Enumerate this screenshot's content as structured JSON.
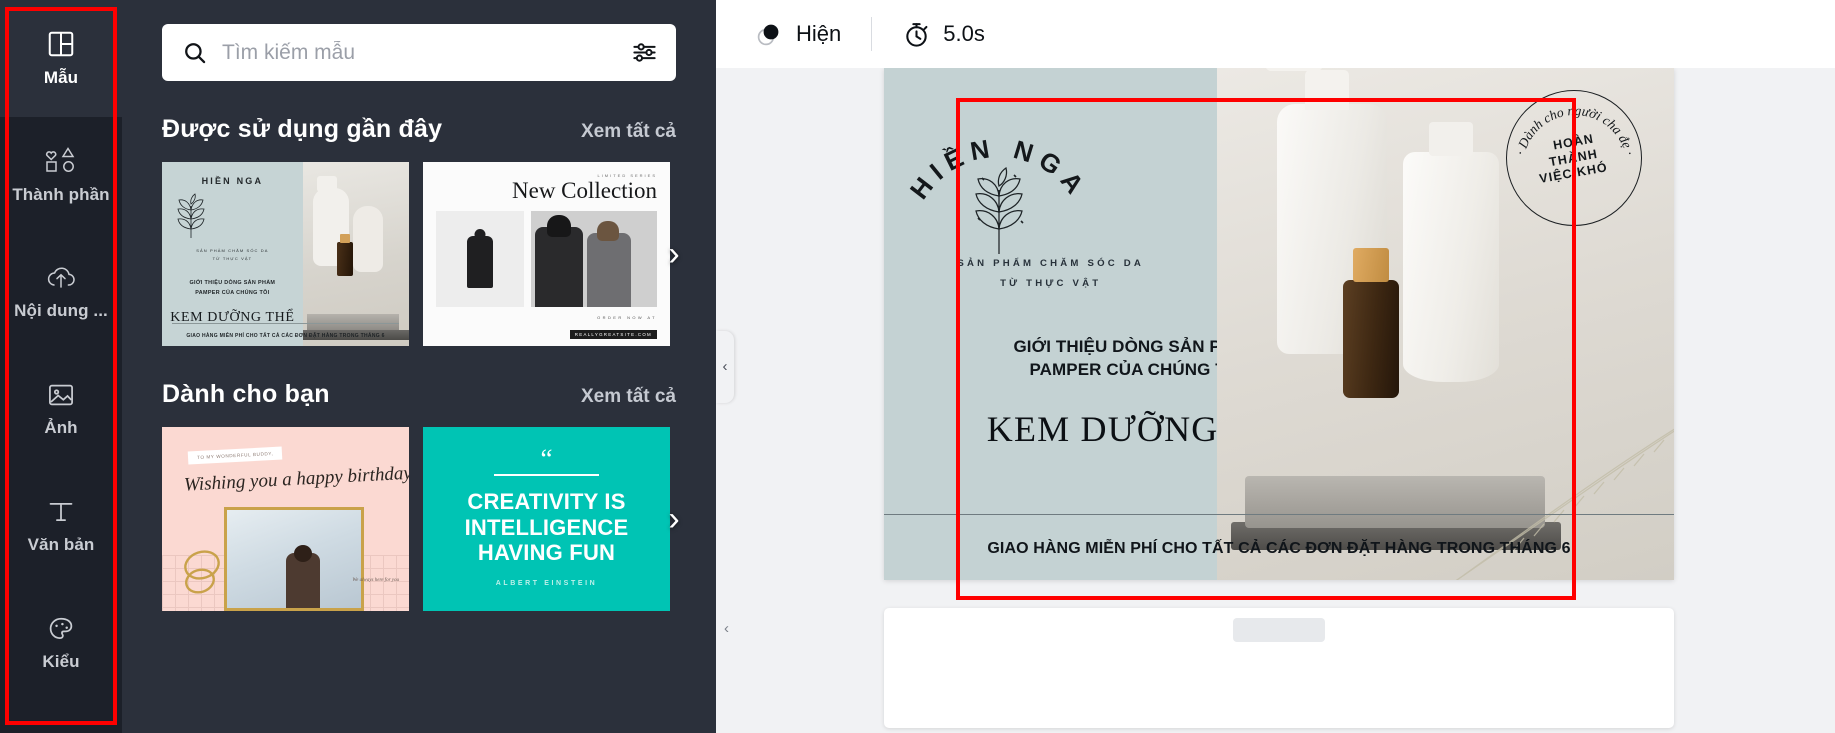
{
  "rail": {
    "items": [
      {
        "label": "Mẫu",
        "icon": "templates-icon",
        "active": true
      },
      {
        "label": "Thành phần",
        "icon": "elements-icon",
        "active": false
      },
      {
        "label": "Nội dung ...",
        "icon": "upload-cloud-icon",
        "active": false
      },
      {
        "label": "Ảnh",
        "icon": "photo-icon",
        "active": false
      },
      {
        "label": "Văn bản",
        "icon": "text-icon",
        "active": false
      },
      {
        "label": "Kiểu",
        "icon": "styles-palette-icon",
        "active": false
      }
    ],
    "highlight_color": "#ff0000"
  },
  "search": {
    "placeholder": "Tìm kiếm mẫu",
    "value": "",
    "icon": "search-icon",
    "filter_icon": "filter-sliders-icon"
  },
  "sections": [
    {
      "title": "Được sử dụng gần đây",
      "link": "Xem tất cả",
      "next_arrow": "›",
      "cards": [
        {
          "kind": "skincare",
          "brand": "HIỀN NGA",
          "sub_line1": "SẢN PHẨM CHĂM SÓC DA",
          "sub_line2": "TỪ THỰC VẬT",
          "intro_line1": "GIỚI THIỆU DÒNG SẢN PHẨM",
          "intro_line2": "PAMPER CỦA CHÚNG TÔI",
          "title": "KEM DƯỠNG THỂ",
          "footer": "GIAO HÀNG MIỄN PHÍ CHO TẤT CẢ CÁC ĐƠN ĐẶT HÀNG TRONG THÁNG 6"
        },
        {
          "kind": "fashion",
          "series": "LIMITED SERIES",
          "title": "New Collection",
          "order": "ORDER NOW AT",
          "site": "REALLYGREATSITE.COM"
        }
      ]
    },
    {
      "title": "Dành cho bạn",
      "link": "Xem tất cả",
      "next_arrow": "›",
      "cards": [
        {
          "kind": "birthday",
          "tag": "TO MY WONDERFUL BUDDY,",
          "script": "Wishing you a happy birthday!",
          "note": "We always here for you"
        },
        {
          "kind": "quote",
          "quote_mark": "“",
          "line1": "CREATIVITY IS",
          "line2": "INTELLIGENCE",
          "line3": "HAVING FUN",
          "author": "ALBERT EINSTEIN",
          "bg_color": "#00c4b4"
        }
      ]
    }
  ],
  "topbar": {
    "animate_label": "Hiện",
    "animate_icon": "animate-circles-icon",
    "timer_label": "5.0s",
    "timer_icon": "stopwatch-icon"
  },
  "canvas": {
    "collapse_icon": "‹",
    "design": {
      "brand": "HIỀN NGA",
      "sub_line1": "SẢN PHẨM CHĂM SÓC DA",
      "sub_line2": "TỪ THỰC VẬT",
      "intro_line1": "GIỚI THIỆU DÒNG SẢN PHẨM",
      "intro_line2": "PAMPER CỦA CHÚNG TÔI",
      "title": "KEM DƯỠNG THỂ",
      "footer": "GIAO HÀNG MIỄN PHÍ CHO TẤT CẢ CÁC ĐƠN ĐẶT HÀNG TRONG THÁNG 6",
      "stamp_curved": "Dành cho người cha đẹ",
      "stamp_line1": "HOÀN",
      "stamp_line2": "THÀNH",
      "stamp_line3": "VIỆC KHÓ"
    },
    "selection_color": "#ff0000",
    "prev_page_arrow": "‹"
  }
}
